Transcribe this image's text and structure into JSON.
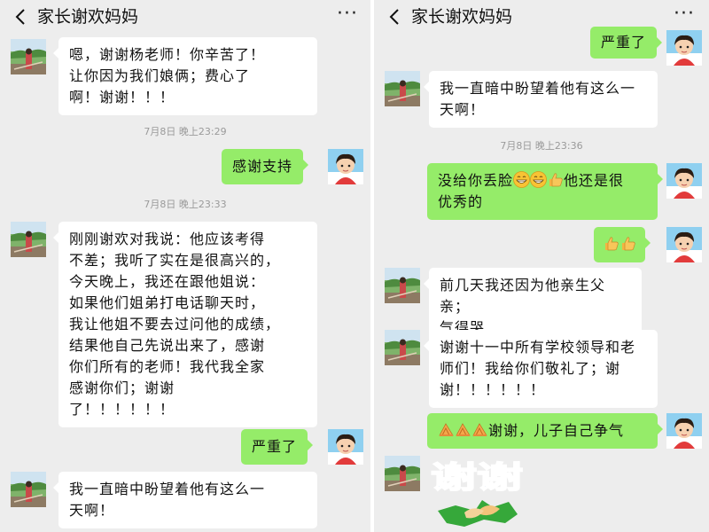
{
  "screenshots": [
    {
      "header": {
        "title": "家长谢欢妈妈"
      },
      "messages": [
        {
          "dir": "in",
          "text": "嗯，谢谢杨老师！你辛苦了！\n让你因为我们娘俩；费心了\n啊！谢谢！！！"
        },
        {
          "dir": "time",
          "text": "7月8日 晚上23:29"
        },
        {
          "dir": "out",
          "text": "感谢支持"
        },
        {
          "dir": "time",
          "text": "7月8日 晚上23:33"
        },
        {
          "dir": "in",
          "text": "刚刚谢欢对我说：他应该考得\n不差；我听了实在是很高兴的，\n今天晚上，我还在跟他姐说：\n如果他们姐弟打电话聊天时，\n我让他姐不要去过问他的成绩，\n结果他自己先说出来了，感谢\n你们所有的老师！我代我全家\n感谢你们；谢谢\n了！！！！！！"
        },
        {
          "dir": "out",
          "text": "严重了"
        },
        {
          "dir": "in",
          "text": "我一直暗中盼望着他有这么一\n天啊！"
        }
      ]
    },
    {
      "header": {
        "title": "家长谢欢妈妈"
      },
      "messages": [
        {
          "dir": "out",
          "text": "严重了"
        },
        {
          "dir": "in",
          "text": "我一直暗中盼望着他有这么一\n天啊！"
        },
        {
          "dir": "time",
          "text": "7月8日 晚上23:36"
        },
        {
          "dir": "out",
          "text_a": "没给你丢脸",
          "text_b": "他还是很\n优秀的",
          "emojis": [
            "grin",
            "grin",
            "thumbs-up"
          ]
        },
        {
          "dir": "out",
          "emojis": [
            "thumbs-up",
            "thumbs-up"
          ]
        },
        {
          "dir": "in",
          "text": "前几天我还因为他亲生父亲；\n气得哭"
        },
        {
          "dir": "in",
          "text": "谢谢十一中所有学校领导和老\n师们！我给你们敬礼了；谢\n谢！！！！！！"
        },
        {
          "dir": "out",
          "text": "谢谢，儿子自己争气",
          "emojis": [
            "salute",
            "salute",
            "salute"
          ]
        },
        {
          "dir": "in",
          "sticker": "thank-you-sticker",
          "sticker_text": "谢谢"
        }
      ]
    }
  ],
  "colors": {
    "background": "#ededed",
    "incoming_bubble": "#ffffff",
    "outgoing_bubble": "#95ec69",
    "timestamp": "#9a9a9a"
  }
}
